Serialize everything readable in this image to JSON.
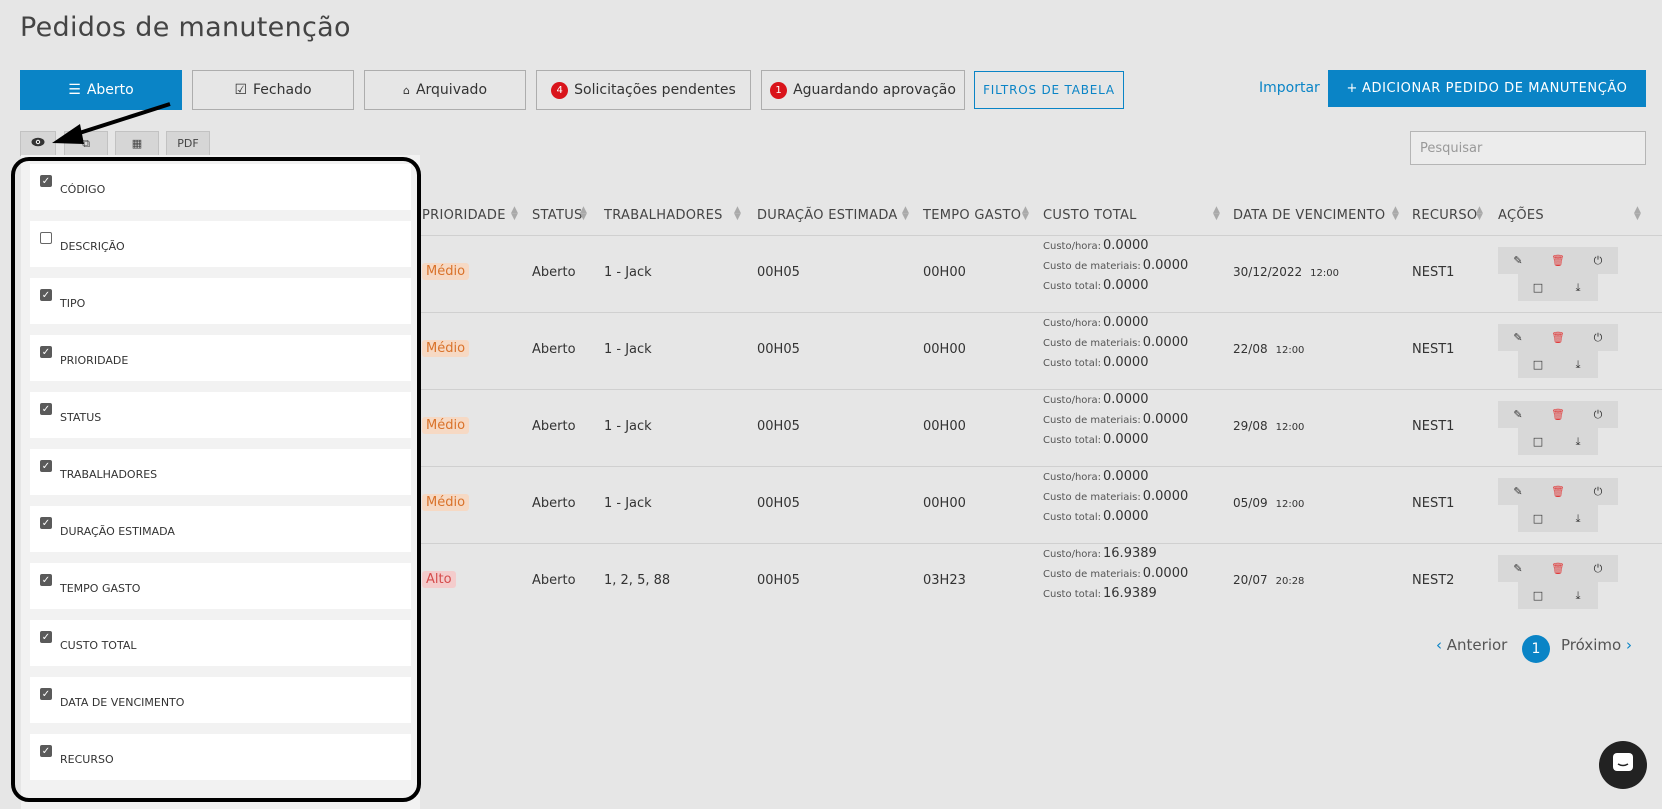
{
  "page": {
    "title": "Pedidos de manutenção"
  },
  "tabs": [
    {
      "label": "Aberto",
      "icon": "list-icon"
    },
    {
      "label": "Fechado",
      "icon": "check-square-icon"
    },
    {
      "label": "Arquivado",
      "icon": "inbox-icon"
    },
    {
      "label": "Solicitações pendentes",
      "badge": "4"
    },
    {
      "label": "Aguardando aprovação",
      "badge": "1"
    }
  ],
  "filters_button": "FILTROS DE TABELA",
  "import_link": "Importar",
  "add_button": "ADICIONAR PEDIDO DE MANUTENÇÃO",
  "toolbar": {
    "pdf": "PDF"
  },
  "search": {
    "placeholder": "Pesquisar"
  },
  "columns_menu": [
    {
      "label": "CÓDIGO",
      "checked": true
    },
    {
      "label": "DESCRIÇÃO",
      "checked": false
    },
    {
      "label": "TIPO",
      "checked": true
    },
    {
      "label": "PRIORIDADE",
      "checked": true
    },
    {
      "label": "STATUS",
      "checked": true
    },
    {
      "label": "TRABALHADORES",
      "checked": true
    },
    {
      "label": "DURAÇÃO ESTIMADA",
      "checked": true
    },
    {
      "label": "TEMPO GASTO",
      "checked": true
    },
    {
      "label": "CUSTO TOTAL",
      "checked": true
    },
    {
      "label": "DATA DE VENCIMENTO",
      "checked": true
    },
    {
      "label": "RECURSO",
      "checked": true
    }
  ],
  "table": {
    "headers": [
      "PRIORIDADE",
      "STATUS",
      "TRABALHADORES",
      "DURAÇÃO ESTIMADA",
      "TEMPO GASTO",
      "CUSTO TOTAL",
      "DATA DE VENCIMENTO",
      "RECURSO",
      "AÇÕES"
    ],
    "cost_labels": {
      "hour": "Custo/hora:",
      "materials": "Custo de materiais:",
      "total": "Custo total:"
    },
    "rows": [
      {
        "priority": "Médio",
        "priority_level": "medio",
        "status": "Aberto",
        "workers": "1 - Jack",
        "estimated": "00H05",
        "spent": "00H00",
        "cost_hour": "0.0000",
        "cost_materials": "0.0000",
        "cost_total": "0.0000",
        "due_date": "30/12/2022",
        "due_time": "12:00",
        "resource": "NEST1"
      },
      {
        "priority": "Médio",
        "priority_level": "medio",
        "status": "Aberto",
        "workers": "1 - Jack",
        "estimated": "00H05",
        "spent": "00H00",
        "cost_hour": "0.0000",
        "cost_materials": "0.0000",
        "cost_total": "0.0000",
        "due_date": "22/08",
        "due_time": "12:00",
        "resource": "NEST1"
      },
      {
        "priority": "Médio",
        "priority_level": "medio",
        "status": "Aberto",
        "workers": "1 - Jack",
        "estimated": "00H05",
        "spent": "00H00",
        "cost_hour": "0.0000",
        "cost_materials": "0.0000",
        "cost_total": "0.0000",
        "due_date": "29/08",
        "due_time": "12:00",
        "resource": "NEST1"
      },
      {
        "priority": "Médio",
        "priority_level": "medio",
        "status": "Aberto",
        "workers": "1 - Jack",
        "estimated": "00H05",
        "spent": "00H00",
        "cost_hour": "0.0000",
        "cost_materials": "0.0000",
        "cost_total": "0.0000",
        "due_date": "05/09",
        "due_time": "12:00",
        "resource": "NEST1"
      },
      {
        "priority": "Alto",
        "priority_level": "alto",
        "status": "Aberto",
        "workers": "1, 2, 5, 88",
        "estimated": "00H05",
        "spent": "03H23",
        "cost_hour": "16.9389",
        "cost_materials": "0.0000",
        "cost_total": "16.9389",
        "due_date": "20/07",
        "due_time": "20:28",
        "resource": "NEST2"
      }
    ]
  },
  "pagination": {
    "prev": "Anterior",
    "current": "1",
    "next": "Próximo"
  },
  "colors": {
    "accent": "#0a84c6",
    "badge": "#d9141b",
    "medio": "#d9722a",
    "alto": "#d44c4c"
  }
}
